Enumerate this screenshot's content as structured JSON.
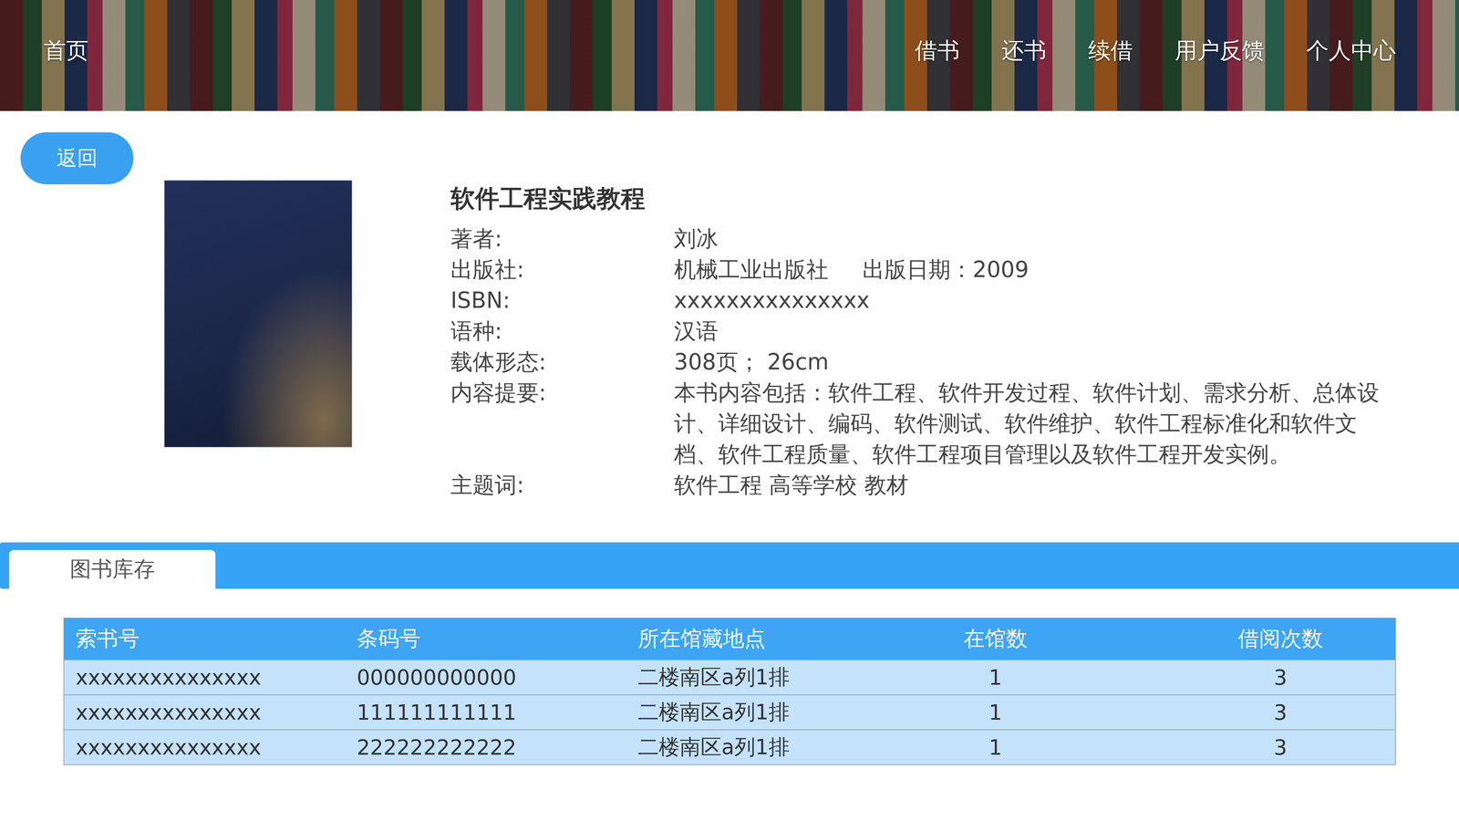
{
  "nav": {
    "home": "首页",
    "items": [
      "借书",
      "还书",
      "续借",
      "用户反馈",
      "个人中心"
    ]
  },
  "back_button": "返回",
  "book": {
    "title": "软件工程实践教程",
    "fields": [
      {
        "label": "著者:",
        "value": "刘冰"
      },
      {
        "label": "出版社:",
        "value": "机械工业出版社",
        "extra": "出版日期：2009"
      },
      {
        "label": "ISBN:",
        "value": "xxxxxxxxxxxxxxx"
      },
      {
        "label": "语种:",
        "value": "汉语"
      },
      {
        "label": "载体形态:",
        "value": "308页； 26cm"
      },
      {
        "label": "内容提要:",
        "value": "本书内容包括：软件工程、软件开发过程、软件计划、需求分析、总体设计、详细设计、编码、软件测试、软件维护、软件工程标准化和软件文档、软件工程质量、软件工程项目管理以及软件工程开发实例。"
      },
      {
        "label": "主题词:",
        "value": "软件工程 高等学校 教材"
      }
    ]
  },
  "tabs": [
    {
      "label": "图书库存",
      "selected": true
    }
  ],
  "table": {
    "columns": [
      "索书号",
      "条码号",
      "所在馆藏地点",
      "在馆数",
      "借阅次数"
    ],
    "rows": [
      [
        "xxxxxxxxxxxxxxx",
        "000000000000",
        "二楼南区a列1排",
        "1",
        "3"
      ],
      [
        "xxxxxxxxxxxxxxx",
        "111111111111",
        "二楼南区a列1排",
        "1",
        "3"
      ],
      [
        "xxxxxxxxxxxxxxx",
        "222222222222",
        "二楼南区a列1排",
        "1",
        "3"
      ]
    ]
  }
}
